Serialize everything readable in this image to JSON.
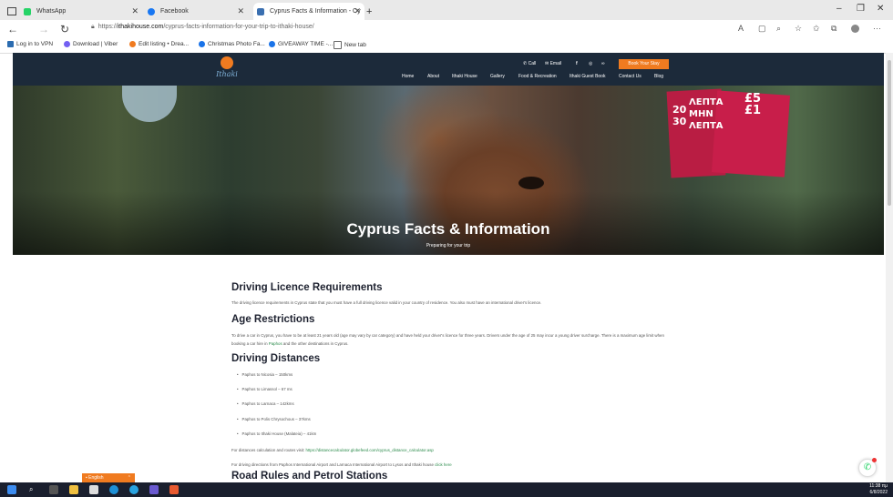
{
  "browser": {
    "tabs": [
      {
        "title": "WhatsApp",
        "color": "#25d366"
      },
      {
        "title": "Facebook",
        "color": "#1877f2"
      },
      {
        "title": "Cyprus Facts & Information - Cy",
        "color": "#3a6fb0"
      }
    ],
    "new_tab": "+",
    "url_prefix": "https://",
    "url_domain": "ithakihouse.com",
    "url_path": "/cyprus-facts-information-for-your-trip-to-ithaki-house/",
    "bookmarks": [
      {
        "label": "Log in to VPN",
        "color": "#2b6cb0"
      },
      {
        "label": "Download | Viber",
        "color": "#7360f2"
      },
      {
        "label": "Edit listing • Drea...",
        "color": "#f07b20"
      },
      {
        "label": "Christmas Photo Fa...",
        "color": "#1a73e8"
      },
      {
        "label": "GIVEAWAY TIME -...",
        "color": "#1a73e8"
      },
      {
        "label": "New tab",
        "color": "#666666"
      }
    ]
  },
  "site": {
    "logo_text": "Ithaki",
    "top_links": [
      "Call",
      "Email"
    ],
    "book_button": "Book Your Stay",
    "menu": [
      "Home",
      "About",
      "Ithaki House",
      "Gallery",
      "Food & Recreation",
      "Ithaki Guest Book",
      "Contact Us",
      "Blog"
    ]
  },
  "hero": {
    "title": "Cyprus Facts & Information",
    "subtitle": "Preparing for your trip",
    "sign_lines": [
      "ΛΕΠΤΑ",
      "ΜΗΝ",
      "ΛΕΠΤΑ"
    ],
    "sign_numbers": [
      "30",
      "20",
      "£5",
      "£1"
    ]
  },
  "article": {
    "h_license": "Driving Licence Requirements",
    "p_license": "The driving licence requirements in Cyprus state that you must have a full driving licence valid in your country of residence. You also must have an international driver's licence.",
    "h_age": "Age Restrictions",
    "p_age_1": "To drive a car in Cyprus, you have to be at least 21 years old (age may vary by car category) and have held your driver's licence for three years. Drivers under the age of 25 may incur a young driver surcharge. There is a maximum age limit when booking a car hire in",
    "p_age_link": "Paphos",
    "p_age_2": "and the other destinations in Cyprus.",
    "h_distances": "Driving Distances",
    "distances": [
      "Paphos to Nicosia – 150kms",
      "Paphos to Limassol – 67 ms",
      "Paphos to Larnaca – 142kms",
      "Paphos to Polis Chrysochous – 37kms",
      "Paphos to Ithaki House (Malateia) – 41km"
    ],
    "p_calc_1": "For distances calculation and routes visit:",
    "p_calc_link": "https://distancecalculator.globefeed.com/cyprus_distance_calculator.asp",
    "p_dir_1": "For driving directions from Paphos International Airport and Larnaca International Airport to Lysos and Ithaki house",
    "p_dir_link": "click here",
    "h_road": "Road Rules and Petrol Stations"
  },
  "widgets": {
    "language": "English",
    "clock_time": "11:38 πμ",
    "clock_date": "6/8/2022"
  }
}
